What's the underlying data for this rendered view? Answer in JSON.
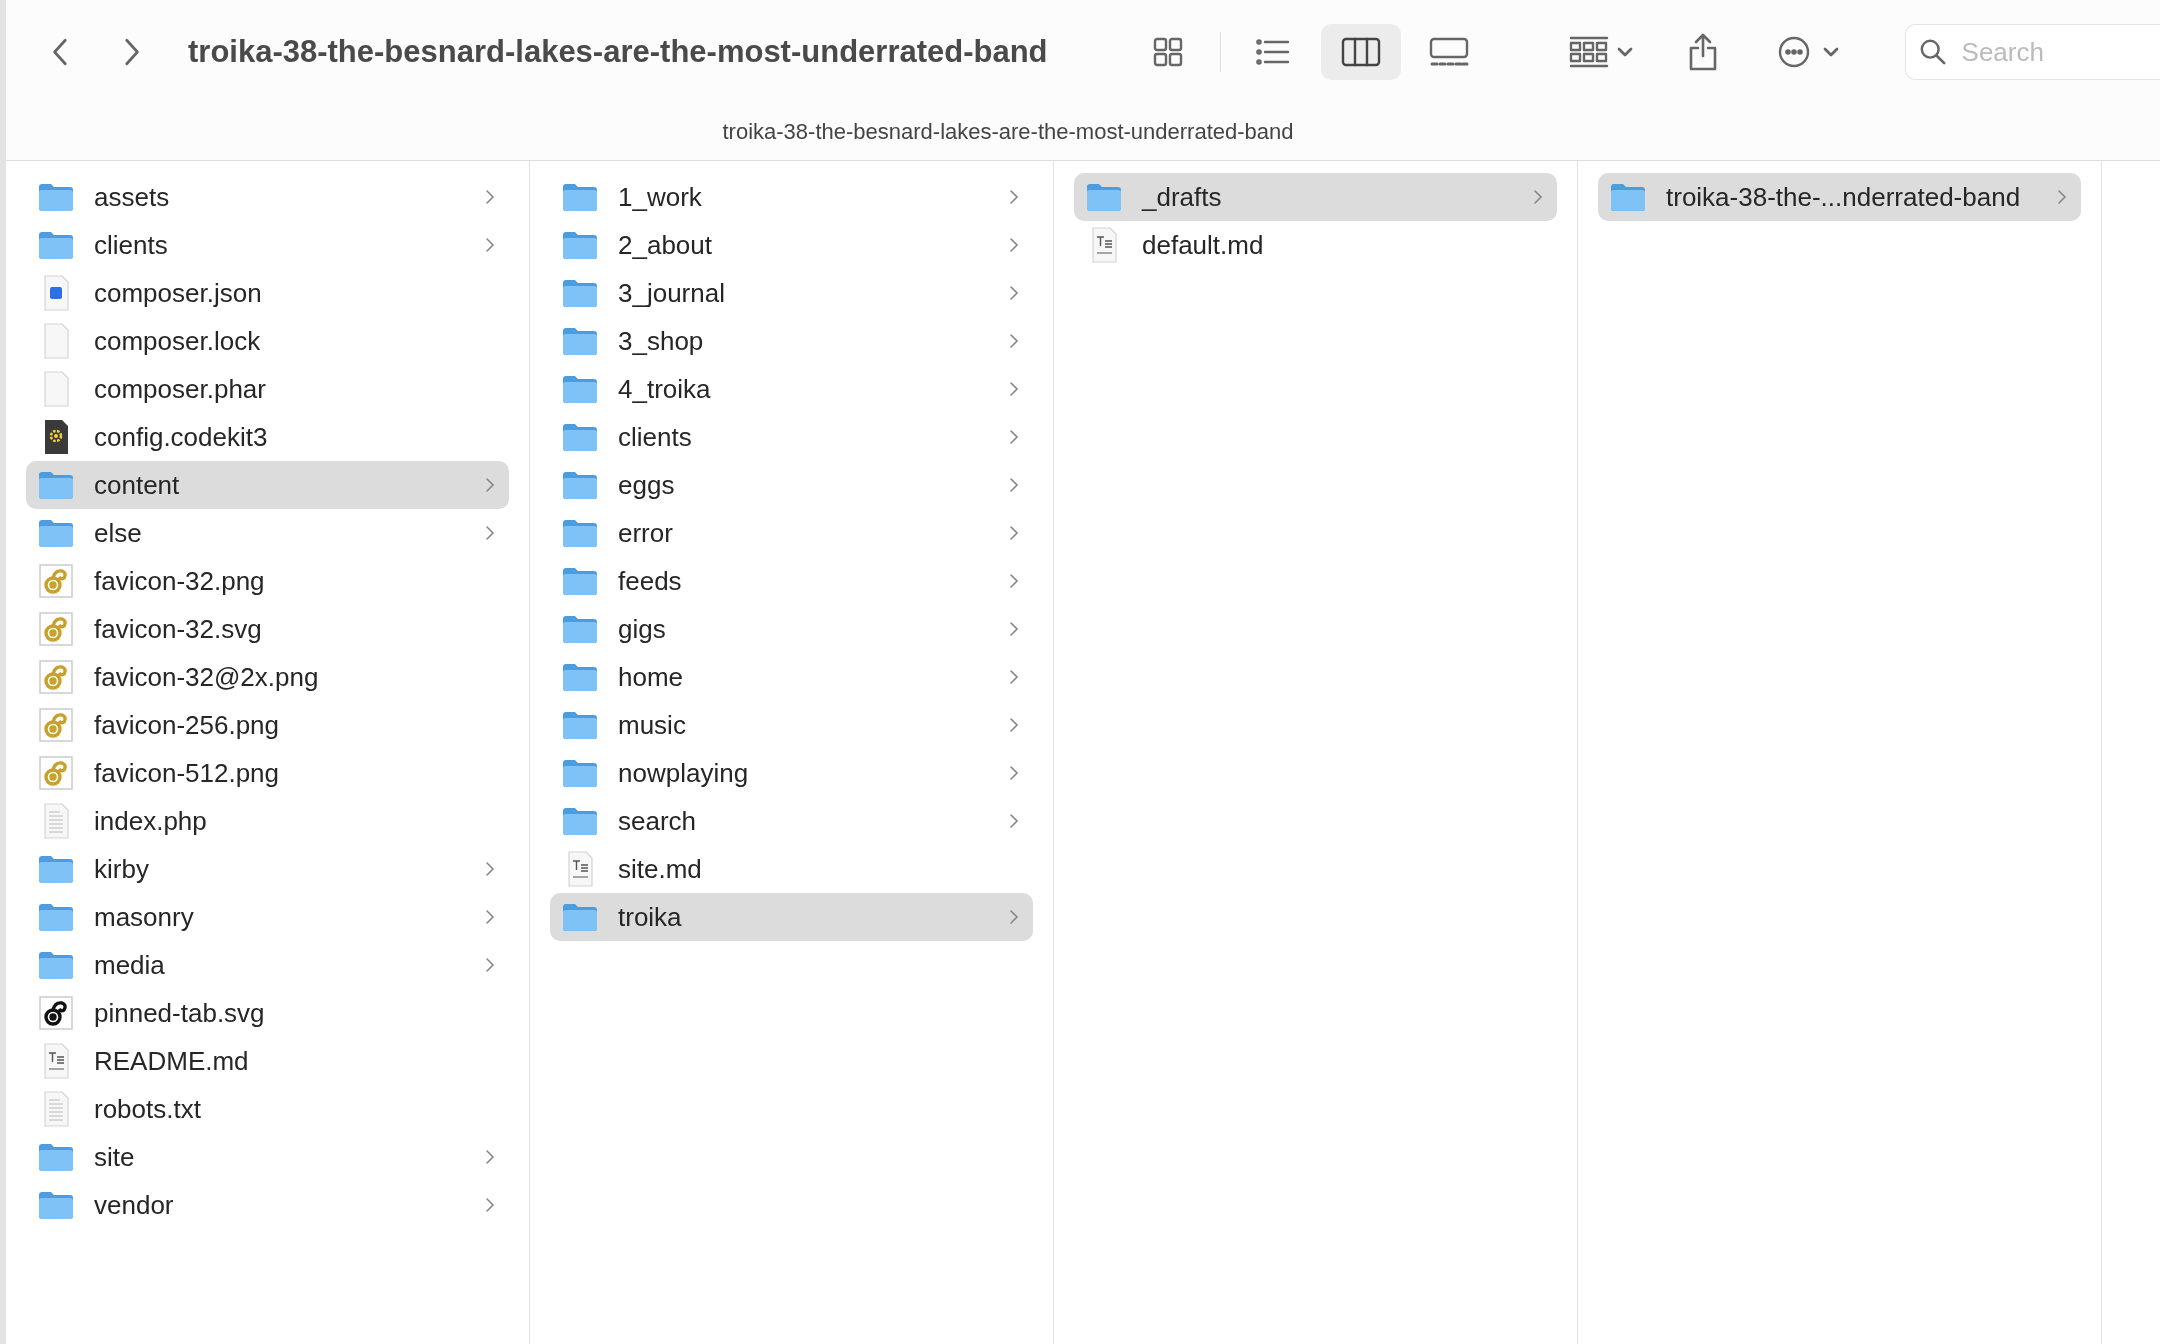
{
  "toolbar": {
    "title": "troika-38-the-besnard-lakes-are-the-most-underrated-band",
    "views": [
      {
        "kind": "icons",
        "selected": false
      },
      {
        "kind": "list",
        "selected": false
      },
      {
        "kind": "columns",
        "selected": true
      },
      {
        "kind": "gallery",
        "selected": false
      }
    ],
    "search": {
      "placeholder": "Search"
    }
  },
  "path_bar": "troika-38-the-besnard-lakes-are-the-most-underrated-band",
  "columns": [
    {
      "items": [
        {
          "name": "assets",
          "kind": "folder",
          "selected": false
        },
        {
          "name": "clients",
          "kind": "folder",
          "selected": false
        },
        {
          "name": "composer.json",
          "kind": "json",
          "selected": false
        },
        {
          "name": "composer.lock",
          "kind": "blank",
          "selected": false
        },
        {
          "name": "composer.phar",
          "kind": "blank",
          "selected": false
        },
        {
          "name": "config.codekit3",
          "kind": "codekit",
          "selected": false
        },
        {
          "name": "content",
          "kind": "folder",
          "selected": true
        },
        {
          "name": "else",
          "kind": "folder",
          "selected": false
        },
        {
          "name": "favicon-32.png",
          "kind": "favicon",
          "selected": false
        },
        {
          "name": "favicon-32.svg",
          "kind": "favicon",
          "selected": false
        },
        {
          "name": "favicon-32@2x.png",
          "kind": "favicon",
          "selected": false
        },
        {
          "name": "favicon-256.png",
          "kind": "favicon",
          "selected": false
        },
        {
          "name": "favicon-512.png",
          "kind": "favicon",
          "selected": false
        },
        {
          "name": "index.php",
          "kind": "doc",
          "selected": false
        },
        {
          "name": "kirby",
          "kind": "folder",
          "selected": false
        },
        {
          "name": "masonry",
          "kind": "folder",
          "selected": false
        },
        {
          "name": "media",
          "kind": "folder",
          "selected": false
        },
        {
          "name": "pinned-tab.svg",
          "kind": "pinned",
          "selected": false
        },
        {
          "name": "README.md",
          "kind": "text",
          "selected": false
        },
        {
          "name": "robots.txt",
          "kind": "doc",
          "selected": false
        },
        {
          "name": "site",
          "kind": "folder",
          "selected": false
        },
        {
          "name": "vendor",
          "kind": "folder",
          "selected": false
        }
      ]
    },
    {
      "items": [
        {
          "name": "1_work",
          "kind": "folder",
          "selected": false
        },
        {
          "name": "2_about",
          "kind": "folder",
          "selected": false
        },
        {
          "name": "3_journal",
          "kind": "folder",
          "selected": false
        },
        {
          "name": "3_shop",
          "kind": "folder",
          "selected": false
        },
        {
          "name": "4_troika",
          "kind": "folder",
          "selected": false
        },
        {
          "name": "clients",
          "kind": "folder",
          "selected": false
        },
        {
          "name": "eggs",
          "kind": "folder",
          "selected": false
        },
        {
          "name": "error",
          "kind": "folder",
          "selected": false
        },
        {
          "name": "feeds",
          "kind": "folder",
          "selected": false
        },
        {
          "name": "gigs",
          "kind": "folder",
          "selected": false
        },
        {
          "name": "home",
          "kind": "folder",
          "selected": false
        },
        {
          "name": "music",
          "kind": "folder",
          "selected": false
        },
        {
          "name": "nowplaying",
          "kind": "folder",
          "selected": false
        },
        {
          "name": "search",
          "kind": "folder",
          "selected": false
        },
        {
          "name": "site.md",
          "kind": "text",
          "selected": false
        },
        {
          "name": "troika",
          "kind": "folder",
          "selected": true
        }
      ]
    },
    {
      "items": [
        {
          "name": "_drafts",
          "kind": "folder",
          "selected": true
        },
        {
          "name": "default.md",
          "kind": "text",
          "selected": false
        }
      ]
    },
    {
      "items": [
        {
          "name": "troika-38-the-...nderrated-band",
          "kind": "folder",
          "selected": true
        }
      ]
    }
  ]
}
